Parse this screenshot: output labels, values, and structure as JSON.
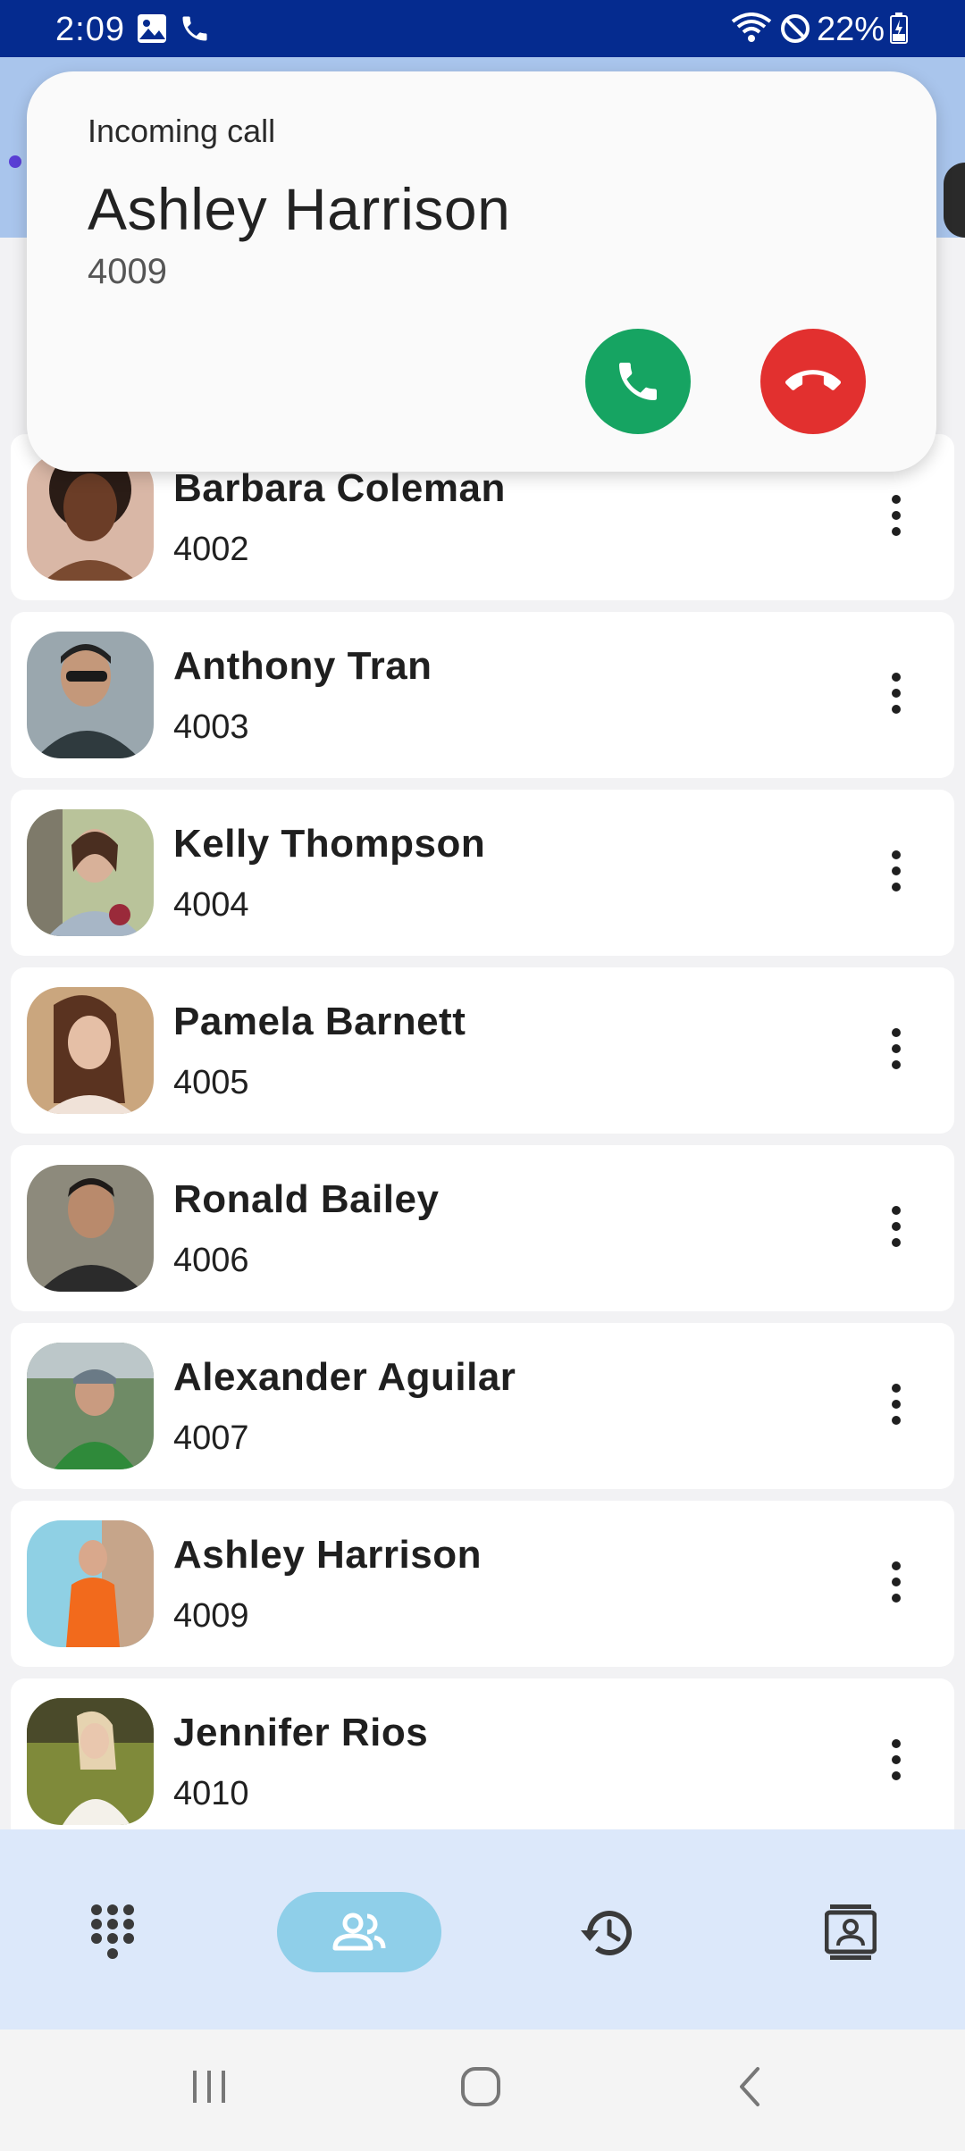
{
  "status_bar": {
    "time": "2:09",
    "battery": "22%",
    "icons": [
      "image-icon",
      "phone-icon",
      "wifi-icon",
      "do-not-disturb-icon",
      "battery-charging-icon"
    ]
  },
  "notification": {
    "label": "Incoming call",
    "caller_name": "Ashley Harrison",
    "caller_number": "4009",
    "answer_icon": "phone-answer-icon",
    "decline_icon": "phone-hangup-icon",
    "answer_color": "#16a462",
    "decline_color": "#e2302f"
  },
  "contacts": [
    {
      "name": "Barbara Coleman",
      "ext": "4002"
    },
    {
      "name": "Anthony Tran",
      "ext": "4003"
    },
    {
      "name": "Kelly Thompson",
      "ext": "4004"
    },
    {
      "name": "Pamela Barnett",
      "ext": "4005"
    },
    {
      "name": "Ronald Bailey",
      "ext": "4006"
    },
    {
      "name": "Alexander Aguilar",
      "ext": "4007"
    },
    {
      "name": "Ashley Harrison",
      "ext": "4009"
    },
    {
      "name": "Jennifer Rios",
      "ext": "4010"
    }
  ],
  "bottom_nav": {
    "items": [
      {
        "id": "dialpad",
        "icon": "dialpad-icon",
        "active": false
      },
      {
        "id": "contacts",
        "icon": "contacts-icon",
        "active": true
      },
      {
        "id": "history",
        "icon": "history-icon",
        "active": false
      },
      {
        "id": "directory",
        "icon": "directory-icon",
        "active": false
      }
    ],
    "active_color": "#8fcfe9"
  },
  "system_nav": [
    "recents-icon",
    "home-icon",
    "back-icon"
  ]
}
